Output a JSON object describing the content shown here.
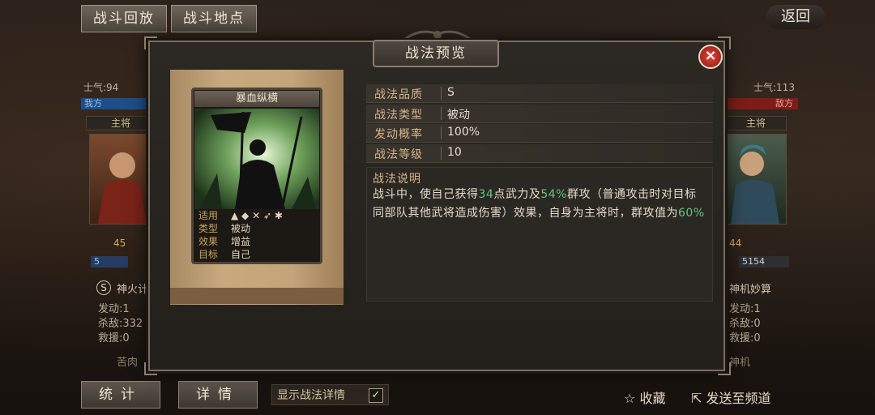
{
  "top_bar": {
    "replay_label": "战斗回放",
    "location_label": "战斗地点",
    "back_label": "返回"
  },
  "left_side": {
    "morale": "士气:94",
    "team": "我方",
    "commander": "主将",
    "unit_text": "45",
    "troop": "5",
    "tactic_name": "神火计",
    "stats": [
      "发动:1",
      "杀敌:332",
      "救援:0"
    ],
    "next_tactic": "苦肉"
  },
  "right_side": {
    "morale": "士气:113",
    "team": "敌方",
    "commander": "主将",
    "troops": "5154",
    "unit_text": "44",
    "tactic_name": "神机妙算",
    "stats": [
      "发动:1",
      "杀敌:0",
      "救援:0"
    ],
    "next_tactic": "神机"
  },
  "bottom_bar": {
    "stats_label": "统计",
    "detail_label": "详情",
    "toggle_label": "显示战法详情",
    "toggle_checked": "✓",
    "favorite_label": "收藏",
    "send_label": "发送至频道"
  },
  "modal": {
    "title": "战法预览",
    "close": "×",
    "card": {
      "name": "暴血纵横",
      "rows": [
        {
          "key": "适用",
          "value": ""
        },
        {
          "key": "类型",
          "value": "被动"
        },
        {
          "key": "效果",
          "value": "增益"
        },
        {
          "key": "目标",
          "value": "自己"
        }
      ]
    },
    "info": [
      {
        "key": "战法品质",
        "value": "S"
      },
      {
        "key": "战法类型",
        "value": "被动"
      },
      {
        "key": "发动概率",
        "value": "100%"
      },
      {
        "key": "战法等级",
        "value": "10"
      }
    ],
    "description": {
      "title": "战法说明",
      "part1": "战斗中，使自己获得",
      "num1": "34",
      "part2": "点武力及",
      "num2": "54%",
      "part3": "群攻（普通攻击时对目标同部队其他武将造成伤害）效果，自身为主将时，群攻值为",
      "num3": "60%"
    }
  },
  "colors": {
    "highlight": "#66c67e",
    "label_gold": "#d5b78a",
    "close_red": "#c8291f"
  }
}
